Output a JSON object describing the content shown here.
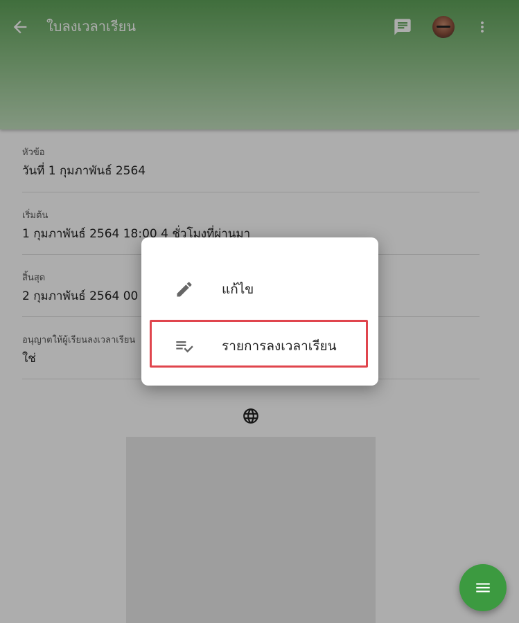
{
  "appbar": {
    "title": "ใบลงเวลาเรียน",
    "back_icon": "arrow-back-icon",
    "chat_icon": "chat-icon",
    "more_icon": "more-vert-icon",
    "gradient_colors": [
      "#5fa35a",
      "#c2dfbe"
    ]
  },
  "fields": [
    {
      "label": "หัวข้อ",
      "value": "วันที่ 1 กุมภาพันธ์ 2564"
    },
    {
      "label": "เริ่มต้น",
      "value": "1 กุมภาพันธ์ 2564 18:00 4 ชั่วโมงที่ผ่านมา"
    },
    {
      "label": "สิ้นสุด",
      "value": "2 กุมภาพันธ์ 2564 00"
    },
    {
      "label": "อนุญาตให้ผู้เรียนลงเวลาเรียน",
      "value": "ใช่"
    }
  ],
  "menu": {
    "items": [
      {
        "label": "แก้ไข",
        "icon": "edit-icon"
      },
      {
        "label": "รายการลงเวลาเรียน",
        "icon": "playlist-check-icon"
      }
    ],
    "highlight_color": "#e0454d"
  },
  "fab": {
    "icon": "menu-icon",
    "color": "#3c9a40"
  },
  "globe_icon": "globe-icon"
}
